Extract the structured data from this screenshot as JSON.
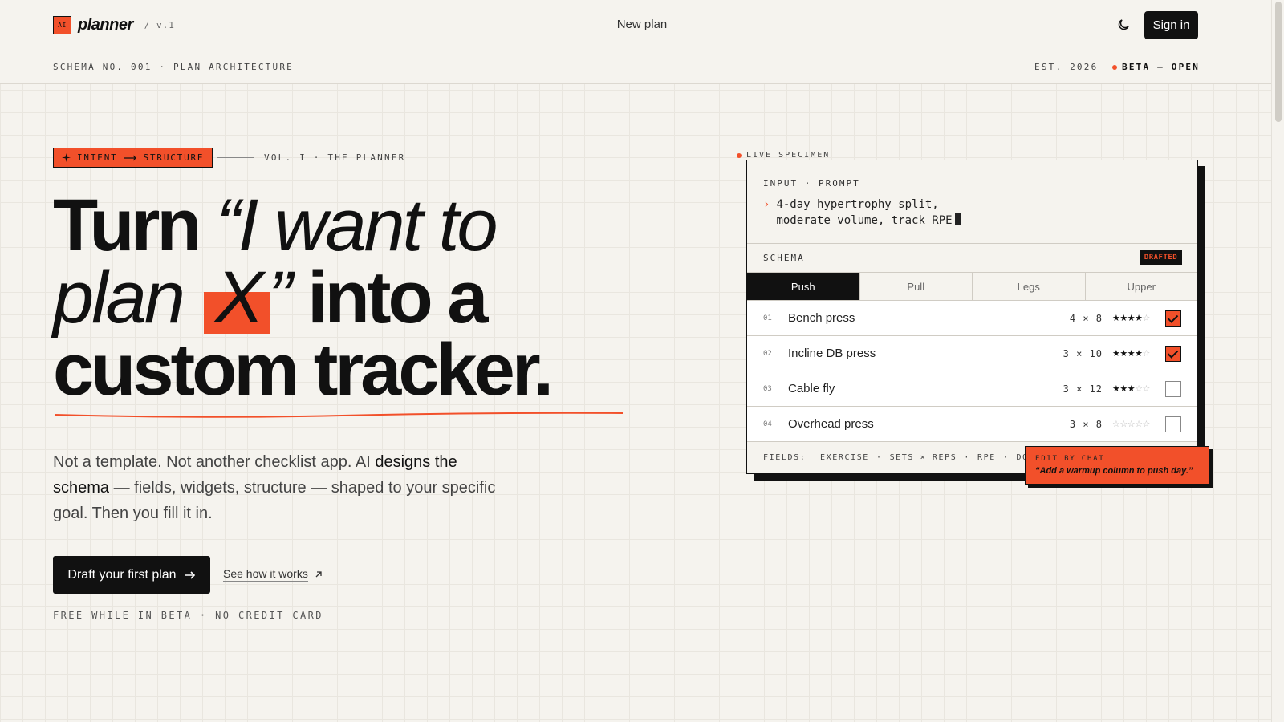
{
  "nav": {
    "logo_mark": "AI",
    "logo_text": "planner",
    "version": "/ v.1",
    "center_link": "New plan",
    "signin": "Sign in"
  },
  "subbar": {
    "schema": "SCHEMA NO. 001 · PLAN ARCHITECTURE",
    "est": "EST. 2026",
    "beta": "BETA — OPEN"
  },
  "hero": {
    "tag_left": "INTENT",
    "tag_right": "STRUCTURE",
    "vol": "VOL. I · THE PLANNER",
    "h_turn": "Turn",
    "h_quote1": "“I want to",
    "h_plan": "plan",
    "h_x": "X",
    "h_quote2": "”",
    "h_into": "into a",
    "h_line3": "custom tracker.",
    "lead_1": "Not a template. Not another checklist app. AI ",
    "lead_bold": "designs the schema",
    "lead_2": " — fields, widgets, structure — shaped to your specific goal. Then you fill it in.",
    "cta": "Draft your first plan",
    "how": "See how it works",
    "free": "FREE WHILE IN BETA · NO CREDIT CARD"
  },
  "specimen": {
    "live": "LIVE SPECIMEN",
    "input_label": "INPUT · PROMPT",
    "prompt_line1": "4-day hypertrophy split,",
    "prompt_line2": "moderate volume, track RPE",
    "schema_label": "SCHEMA",
    "status": "DRAFTED",
    "tabs": [
      "Push",
      "Pull",
      "Legs",
      "Upper"
    ],
    "rows": [
      {
        "num": "01",
        "name": "Bench press",
        "sets": "4 × 8",
        "rating": 4,
        "done": true
      },
      {
        "num": "02",
        "name": "Incline DB press",
        "sets": "3 × 10",
        "rating": 4,
        "done": true
      },
      {
        "num": "03",
        "name": "Cable fly",
        "sets": "3 × 12",
        "rating": 3,
        "done": false
      },
      {
        "num": "04",
        "name": "Overhead press",
        "sets": "3 × 8",
        "rating": 0,
        "done": false
      }
    ],
    "fields_label": "FIELDS:",
    "fields": [
      "EXERCISE",
      "SETS × REPS",
      "RPE",
      "DONE"
    ],
    "edit_label": "EDIT BY CHAT",
    "edit_text": "“Add a warmup column to push day.”"
  },
  "colors": {
    "accent": "#f2502a",
    "ink": "#111111",
    "paper": "#f5f3ee"
  }
}
